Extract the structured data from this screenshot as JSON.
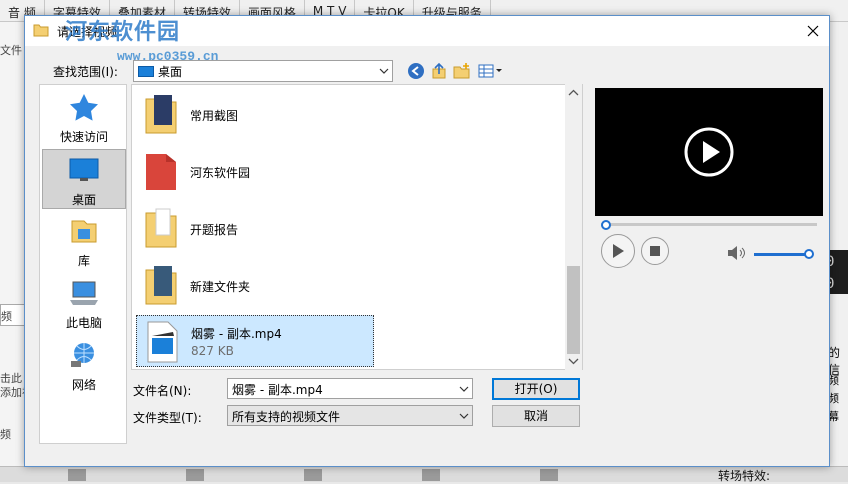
{
  "app": {
    "menu": [
      "音 频",
      "字幕特效",
      "叠加素材",
      "转场特效",
      "画面风格",
      "M T V",
      "卡拉OK",
      "升级与服务"
    ],
    "left_strips": [
      "文件",
      "频",
      "击此",
      "添加视",
      "频"
    ],
    "right_digits": [
      "0",
      "0"
    ],
    "right_strips": [
      "的信",
      "频",
      "频",
      "幕"
    ],
    "transition_label": "转场特效:"
  },
  "dialog": {
    "title": "请选择视频",
    "watermark": "河东软件园",
    "watermark_url": "www.pc0359.cn",
    "lookin_label": "查找范围(I):",
    "lookin_value": "桌面",
    "places": [
      {
        "label": "快速访问"
      },
      {
        "label": "桌面"
      },
      {
        "label": "库"
      },
      {
        "label": "此电脑"
      },
      {
        "label": "网络"
      }
    ],
    "files": [
      {
        "name": "常用截图"
      },
      {
        "name": "河东软件园"
      },
      {
        "name": "开题报告"
      },
      {
        "name": "新建文件夹"
      },
      {
        "name": "烟雾 - 副本.mp4",
        "size": "827 KB"
      }
    ],
    "filename_label": "文件名(N):",
    "filename_value": "烟雾 - 副本.mp4",
    "filetype_label": "文件类型(T):",
    "filetype_value": "所有支持的视频文件",
    "open_label": "打开(O)",
    "cancel_label": "取消"
  },
  "colors": {
    "accent": "#0078d7",
    "selection": "#cce8ff",
    "folder": "#f4cf72"
  }
}
